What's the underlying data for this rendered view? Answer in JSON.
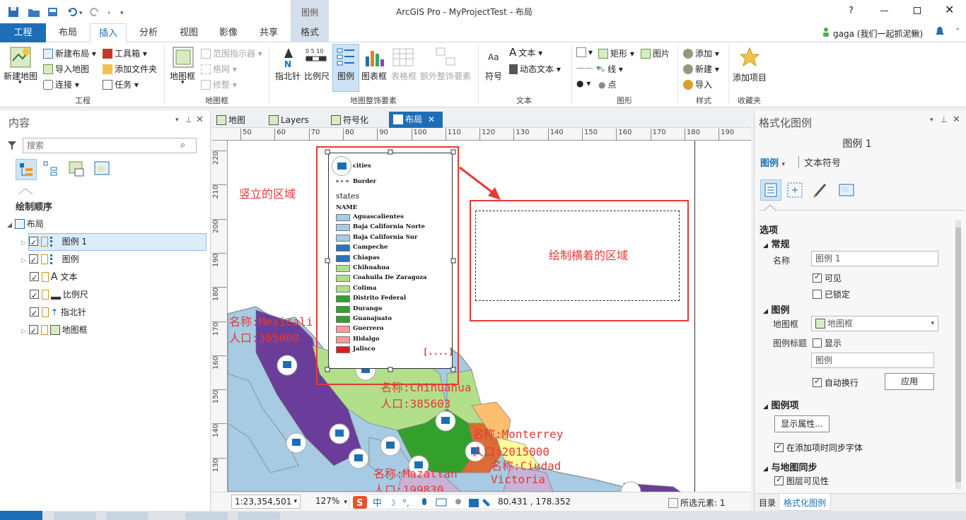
{
  "app": {
    "title": "ArcGIS Pro - MyProjectTest - 布局",
    "context_group": "图例",
    "user": "gaga (我们一起抓泥鳅)",
    "help": "?"
  },
  "ribbon_tabs": [
    "工程",
    "布局",
    "插入",
    "分析",
    "视图",
    "影像",
    "共享",
    "格式"
  ],
  "ribbon": {
    "project": {
      "new_map": "新建地图",
      "new_layout": "新建布局",
      "import_map": "导入地图",
      "connect": "连接",
      "toolbox": "工具箱",
      "add_folder": "添加文件夹",
      "task": "任务",
      "group": "工程"
    },
    "mapframe": {
      "map_frame": "地图框",
      "extent_indicator": "范围指示器",
      "grid": "格网",
      "reshape": "修整",
      "group": "地图框"
    },
    "surround": {
      "north_arrow": "指北针",
      "scale_bar": "比例尺",
      "legend": "图例",
      "chart_frame": "图表框",
      "table_frame": "表格框",
      "extra": "额外整饰要素",
      "group": "地图整饰要素"
    },
    "text": {
      "symbol": "符号",
      "text": "文本",
      "dynamic_text": "动态文本",
      "group": "文本"
    },
    "graphics": {
      "rectangle": "矩形",
      "line": "线",
      "point": "点",
      "picture": "图片",
      "group": "图形"
    },
    "styles": {
      "add": "添加",
      "new": "新建",
      "import": "导入",
      "group": "样式"
    },
    "favorites": {
      "add_item": "添加项目",
      "group": "收藏夹"
    }
  },
  "contents": {
    "title": "内容",
    "search_placeholder": "搜索",
    "drawing_order": "绘制顺序",
    "root": "布局",
    "items": [
      "图例 1",
      "图例",
      "文本",
      "比例尺",
      "指北针",
      "地图框"
    ]
  },
  "view_tabs": [
    "地图",
    "Layers",
    "符号化",
    "布局"
  ],
  "ruler_top": [
    "50",
    "60",
    "70",
    "80",
    "90",
    "100",
    "110",
    "120",
    "130",
    "140",
    "150",
    "160",
    "170",
    "180",
    "190"
  ],
  "ruler_left": [
    "220",
    "210",
    "200",
    "190",
    "180",
    "170",
    "160",
    "150",
    "140",
    "130"
  ],
  "legend": {
    "cities": "cities",
    "border": "Border",
    "states": "states",
    "name": "NAME",
    "entries": [
      {
        "label": "Aguascalientes",
        "color": "#a6cbe3"
      },
      {
        "label": "Baja California Norte",
        "color": "#a6cbe3"
      },
      {
        "label": "Baja California Sur",
        "color": "#a6cbe3"
      },
      {
        "label": "Campeche",
        "color": "#2a73b8"
      },
      {
        "label": "Chiapas",
        "color": "#2a73b8"
      },
      {
        "label": "Chihuahua",
        "color": "#b2df8a"
      },
      {
        "label": "Coahuila De Zaragoza",
        "color": "#b2df8a"
      },
      {
        "label": "Colima",
        "color": "#b2df8a"
      },
      {
        "label": "Distrito Federal",
        "color": "#33a02c"
      },
      {
        "label": "Durango",
        "color": "#33a02c"
      },
      {
        "label": "Guanajuato",
        "color": "#33a02c"
      },
      {
        "label": "Guerrero",
        "color": "#fb9a99"
      },
      {
        "label": "Hidalgo",
        "color": "#fb9a99"
      },
      {
        "label": "Jalisco",
        "color": "#e31a1c"
      }
    ],
    "overflow": "[....]"
  },
  "annotations": {
    "vertical": "竖立的区域",
    "horizontal": "绘制横着的区域"
  },
  "map_labels": [
    {
      "name": "名称:Mexicali",
      "pop": "人口:365000"
    },
    {
      "name": "名称:Chihuahua",
      "pop": "人口:385603"
    },
    {
      "name": "名称:Monterrey",
      "pop": "人口:2015000"
    },
    {
      "name": "名称:Ciudad",
      "pop": "Victoria"
    },
    {
      "name": "名称:Mazatlan",
      "pop": "人口:199830"
    }
  ],
  "view_status": {
    "scale": "1:23,354,501",
    "zoom": "127%",
    "coords": "80.431 , 178.352",
    "selected": "所选元素: 1"
  },
  "format_pane": {
    "title": "格式化图例",
    "element": "图例 1",
    "tab_legend": "图例",
    "tab_text": "文本符号",
    "options": "选项",
    "general": "常规",
    "name_label": "名称",
    "name_value": "图例 1",
    "visible": "可见",
    "locked": "已锁定",
    "legend_section": "图例",
    "mapframe_label": "地图框",
    "mapframe_value": "地图框",
    "title_label": "图例标题",
    "show": "显示",
    "title_value": "图例",
    "auto_wrap": "自动换行",
    "apply": "应用",
    "items_section": "图例项",
    "show_props": "显示属性...",
    "sync_fonts": "在添加项时同步字体",
    "sync_section": "与地图同步",
    "layer_visibility": "图层可见性",
    "bottom_tab1": "目录",
    "bottom_tab2": "格式化图例"
  },
  "colors": {
    "accent": "#1c6fb7",
    "highlight": "#e53935"
  }
}
